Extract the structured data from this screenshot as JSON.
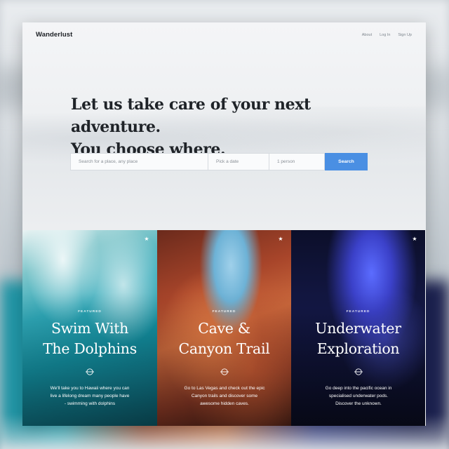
{
  "nav": {
    "brand": "Wanderlust",
    "links": [
      "About",
      "Log In",
      "Sign Up"
    ]
  },
  "hero": {
    "headline": [
      "Let us take care of your next adventure.",
      "You choose where."
    ],
    "search": {
      "place_placeholder": "Search for a place, any place",
      "date_placeholder": "Pick a date",
      "people_placeholder": "1 person",
      "button_label": "Search"
    }
  },
  "tiles": [
    {
      "tag": "FEATURED",
      "title": [
        "Swim With",
        "The Dolphins"
      ],
      "description": [
        "We'll take you to Hawaii where you can",
        "live a lifelong dream many people have",
        "- swimming with dolphins"
      ],
      "icon": "star-icon"
    },
    {
      "tag": "FEATURED",
      "title": [
        "Cave &",
        "Canyon Trail"
      ],
      "description": [
        "Go to Las Vegas and check out the epic",
        "Canyon trails and discover some",
        "awesome hidden caves."
      ],
      "icon": "star-icon"
    },
    {
      "tag": "FEATURED",
      "title": [
        "Underwater",
        "Exploration"
      ],
      "description": [
        "Go deep into the pacific ocean in",
        "specialised underwater pods.",
        "Discover the unknown."
      ],
      "icon": "star-icon"
    }
  ],
  "colors": {
    "accent": "#4a8fe3",
    "text_dark": "#1f2328"
  }
}
